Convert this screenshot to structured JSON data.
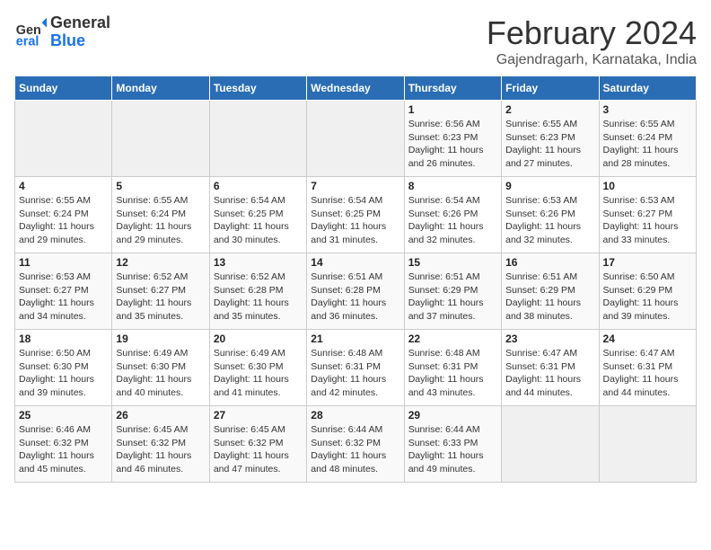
{
  "logo": {
    "line1": "General",
    "line2": "Blue"
  },
  "title": "February 2024",
  "location": "Gajendragarh, Karnataka, India",
  "weekdays": [
    "Sunday",
    "Monday",
    "Tuesday",
    "Wednesday",
    "Thursday",
    "Friday",
    "Saturday"
  ],
  "weeks": [
    [
      {
        "day": "",
        "info": ""
      },
      {
        "day": "",
        "info": ""
      },
      {
        "day": "",
        "info": ""
      },
      {
        "day": "",
        "info": ""
      },
      {
        "day": "1",
        "info": "Sunrise: 6:56 AM\nSunset: 6:23 PM\nDaylight: 11 hours\nand 26 minutes."
      },
      {
        "day": "2",
        "info": "Sunrise: 6:55 AM\nSunset: 6:23 PM\nDaylight: 11 hours\nand 27 minutes."
      },
      {
        "day": "3",
        "info": "Sunrise: 6:55 AM\nSunset: 6:24 PM\nDaylight: 11 hours\nand 28 minutes."
      }
    ],
    [
      {
        "day": "4",
        "info": "Sunrise: 6:55 AM\nSunset: 6:24 PM\nDaylight: 11 hours\nand 29 minutes."
      },
      {
        "day": "5",
        "info": "Sunrise: 6:55 AM\nSunset: 6:24 PM\nDaylight: 11 hours\nand 29 minutes."
      },
      {
        "day": "6",
        "info": "Sunrise: 6:54 AM\nSunset: 6:25 PM\nDaylight: 11 hours\nand 30 minutes."
      },
      {
        "day": "7",
        "info": "Sunrise: 6:54 AM\nSunset: 6:25 PM\nDaylight: 11 hours\nand 31 minutes."
      },
      {
        "day": "8",
        "info": "Sunrise: 6:54 AM\nSunset: 6:26 PM\nDaylight: 11 hours\nand 32 minutes."
      },
      {
        "day": "9",
        "info": "Sunrise: 6:53 AM\nSunset: 6:26 PM\nDaylight: 11 hours\nand 32 minutes."
      },
      {
        "day": "10",
        "info": "Sunrise: 6:53 AM\nSunset: 6:27 PM\nDaylight: 11 hours\nand 33 minutes."
      }
    ],
    [
      {
        "day": "11",
        "info": "Sunrise: 6:53 AM\nSunset: 6:27 PM\nDaylight: 11 hours\nand 34 minutes."
      },
      {
        "day": "12",
        "info": "Sunrise: 6:52 AM\nSunset: 6:27 PM\nDaylight: 11 hours\nand 35 minutes."
      },
      {
        "day": "13",
        "info": "Sunrise: 6:52 AM\nSunset: 6:28 PM\nDaylight: 11 hours\nand 35 minutes."
      },
      {
        "day": "14",
        "info": "Sunrise: 6:51 AM\nSunset: 6:28 PM\nDaylight: 11 hours\nand 36 minutes."
      },
      {
        "day": "15",
        "info": "Sunrise: 6:51 AM\nSunset: 6:29 PM\nDaylight: 11 hours\nand 37 minutes."
      },
      {
        "day": "16",
        "info": "Sunrise: 6:51 AM\nSunset: 6:29 PM\nDaylight: 11 hours\nand 38 minutes."
      },
      {
        "day": "17",
        "info": "Sunrise: 6:50 AM\nSunset: 6:29 PM\nDaylight: 11 hours\nand 39 minutes."
      }
    ],
    [
      {
        "day": "18",
        "info": "Sunrise: 6:50 AM\nSunset: 6:30 PM\nDaylight: 11 hours\nand 39 minutes."
      },
      {
        "day": "19",
        "info": "Sunrise: 6:49 AM\nSunset: 6:30 PM\nDaylight: 11 hours\nand 40 minutes."
      },
      {
        "day": "20",
        "info": "Sunrise: 6:49 AM\nSunset: 6:30 PM\nDaylight: 11 hours\nand 41 minutes."
      },
      {
        "day": "21",
        "info": "Sunrise: 6:48 AM\nSunset: 6:31 PM\nDaylight: 11 hours\nand 42 minutes."
      },
      {
        "day": "22",
        "info": "Sunrise: 6:48 AM\nSunset: 6:31 PM\nDaylight: 11 hours\nand 43 minutes."
      },
      {
        "day": "23",
        "info": "Sunrise: 6:47 AM\nSunset: 6:31 PM\nDaylight: 11 hours\nand 44 minutes."
      },
      {
        "day": "24",
        "info": "Sunrise: 6:47 AM\nSunset: 6:31 PM\nDaylight: 11 hours\nand 44 minutes."
      }
    ],
    [
      {
        "day": "25",
        "info": "Sunrise: 6:46 AM\nSunset: 6:32 PM\nDaylight: 11 hours\nand 45 minutes."
      },
      {
        "day": "26",
        "info": "Sunrise: 6:45 AM\nSunset: 6:32 PM\nDaylight: 11 hours\nand 46 minutes."
      },
      {
        "day": "27",
        "info": "Sunrise: 6:45 AM\nSunset: 6:32 PM\nDaylight: 11 hours\nand 47 minutes."
      },
      {
        "day": "28",
        "info": "Sunrise: 6:44 AM\nSunset: 6:32 PM\nDaylight: 11 hours\nand 48 minutes."
      },
      {
        "day": "29",
        "info": "Sunrise: 6:44 AM\nSunset: 6:33 PM\nDaylight: 11 hours\nand 49 minutes."
      },
      {
        "day": "",
        "info": ""
      },
      {
        "day": "",
        "info": ""
      }
    ]
  ]
}
